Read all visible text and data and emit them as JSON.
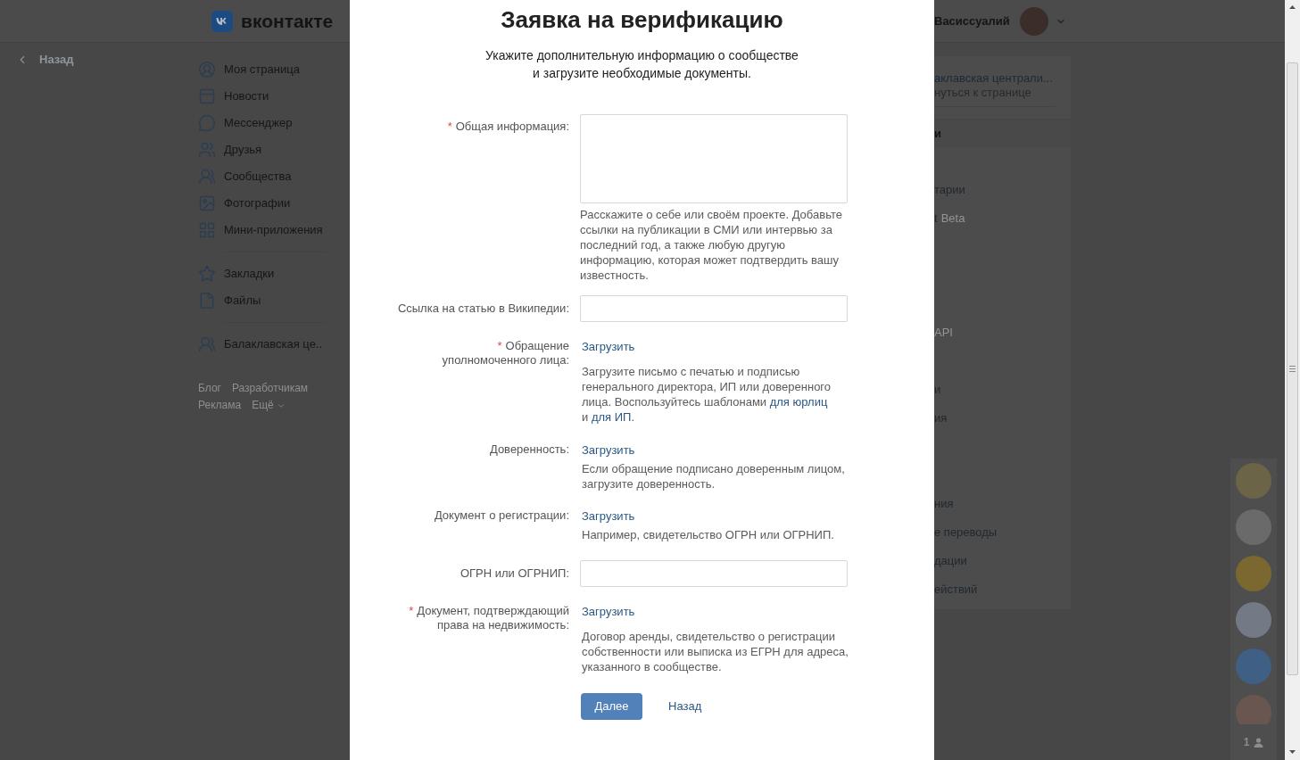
{
  "header": {
    "logo_text": "вконтакте",
    "user_name": "Васиссуалий"
  },
  "back_link": {
    "label": "Назад"
  },
  "sidebar": {
    "groups": [
      {
        "items": [
          {
            "label": "Моя страница"
          },
          {
            "label": "Новости"
          },
          {
            "label": "Мессенджер"
          },
          {
            "label": "Друзья"
          },
          {
            "label": "Сообщества"
          },
          {
            "label": "Фотографии"
          },
          {
            "label": "Мини-приложения"
          }
        ]
      },
      {
        "items": [
          {
            "label": "Закладки"
          },
          {
            "label": "Файлы"
          }
        ]
      },
      {
        "items": [
          {
            "label": "Балаклавская це.."
          }
        ]
      }
    ],
    "footer_links": [
      {
        "label": "Блог"
      },
      {
        "label": "Разработчикам"
      },
      {
        "label": "Реклама"
      }
    ],
    "more_link": {
      "label": "Ещё"
    }
  },
  "modal": {
    "title": "Заявка на верификацию",
    "subtitle": "Укажите дополнительную информацию о сообществе\nи загрузите необходимые документы.",
    "fields": [
      {
        "kind": "textarea",
        "required_mark": "*",
        "label": "Общая информация:",
        "hint": [
          {
            "kind": "text",
            "text": "Расскажите о себе или своём проекте. Добавьте\nссылки на публикации в СМИ или интервью за\nпоследний год, а также любую другую\nинформацию, которая может подтвердить вашу\nизвестность."
          }
        ]
      },
      {
        "kind": "input",
        "label": "Ссылка на статью в Википедии:"
      },
      {
        "kind": "upload",
        "required_mark": "*",
        "label": "Обращение\nуполномоченного лица:",
        "action": "Загрузить",
        "hint": [
          {
            "kind": "text",
            "text": "Загрузите письмо с печатью и подписью\nгенерального директора, ИП или доверенного\nлица. Воспользуйтесь шаблонами "
          },
          {
            "kind": "link",
            "text": "для юрлиц"
          },
          {
            "kind": "text",
            "text": "\nи "
          },
          {
            "kind": "link",
            "text": "для ИП"
          },
          {
            "kind": "text",
            "text": "."
          }
        ]
      },
      {
        "kind": "upload",
        "label": "Доверенность:",
        "action": "Загрузить",
        "hint": [
          {
            "kind": "text",
            "text": "Если обращение подписано доверенным лицом,\nзагрузите доверенность."
          }
        ]
      },
      {
        "kind": "upload",
        "label": "Документ о регистрации:",
        "action": "Загрузить",
        "hint": [
          {
            "kind": "text",
            "text": "Например, свидетельство ОГРН или ОГРНИП."
          }
        ]
      },
      {
        "kind": "input",
        "label": "ОГРН или ОГРНИП:"
      },
      {
        "kind": "upload",
        "required_mark": "*",
        "label": "Документ, подтверждающий\nправа на недвижимость:",
        "action": "Загрузить",
        "hint": [
          {
            "kind": "text",
            "text": "Договор аренды, свидетельство о регистрации\nсобственности или выписка из ЕГРН для адреса,\nуказанного в сообществе."
          }
        ]
      }
    ],
    "buttons": [
      {
        "kind": "primary",
        "label": "Далее"
      },
      {
        "kind": "link",
        "label": "Назад"
      }
    ]
  },
  "right_panel": {
    "community": {
      "name": "аклавская централи...",
      "return_link": "нуться к странице"
    },
    "menu_heading": "и",
    "menu_items": [
      {
        "label": "тарии",
        "greyed": false
      },
      {
        "label": "t",
        "badge": "Beta",
        "greyed": false
      },
      {
        "label": "API",
        "greyed": true
      },
      {
        "label": "и",
        "greyed": false
      },
      {
        "label": "ия",
        "greyed": false
      },
      {
        "label": "ния",
        "greyed": false
      },
      {
        "label": "е переводы",
        "greyed": false
      },
      {
        "label": "дации",
        "greyed": false
      },
      {
        "label": "ействий",
        "greyed": false
      }
    ]
  },
  "chat_bar": {
    "online_count": "1"
  }
}
